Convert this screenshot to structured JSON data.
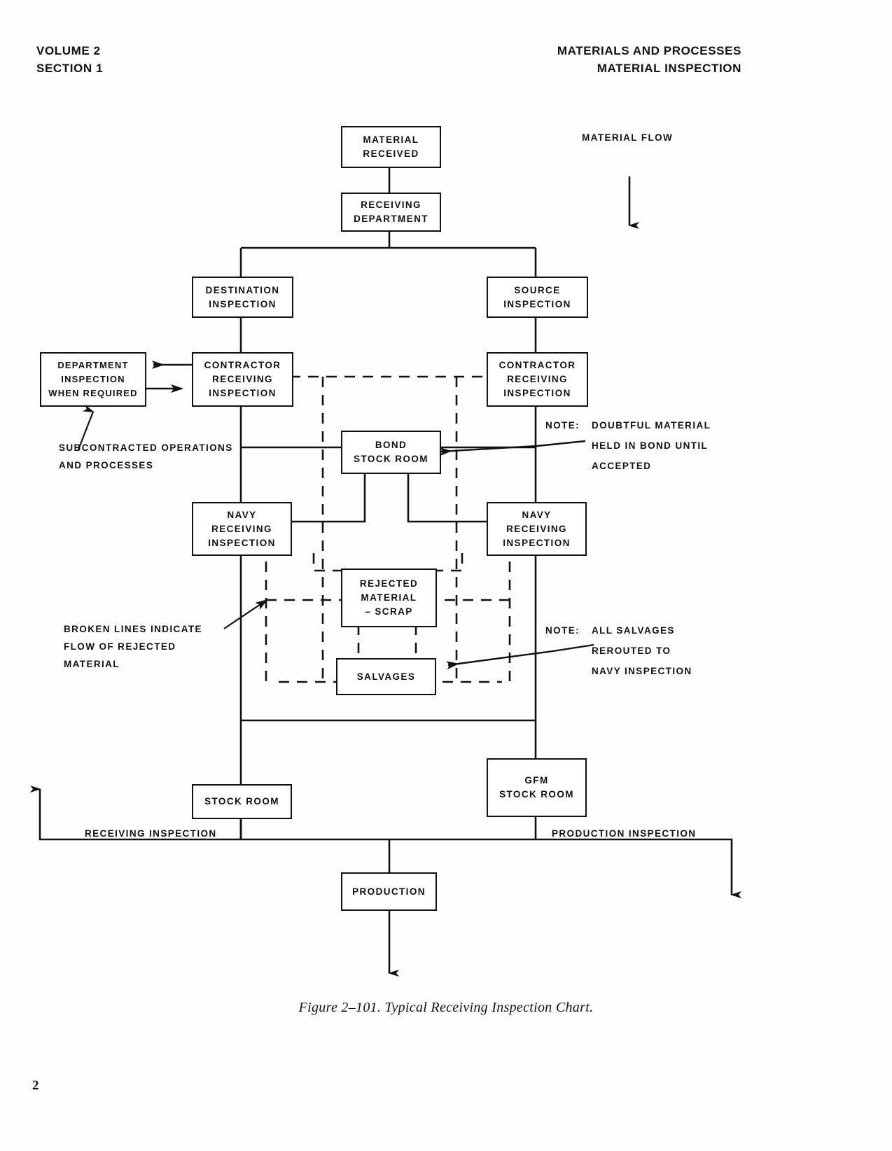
{
  "header": {
    "left_line1": "VOLUME 2",
    "left_line2": "SECTION 1",
    "right_line1": "MATERIALS AND PROCESSES",
    "right_line2": "MATERIAL INSPECTION"
  },
  "page_number": "2",
  "caption": "Figure 2–101.   Typical Receiving Inspection Chart.",
  "legend": {
    "material_flow": "MATERIAL FLOW"
  },
  "annotations": {
    "subcontracted_line1": "SUBCONTRACTED OPERATIONS",
    "subcontracted_line2": "AND PROCESSES",
    "broken_lines_line1": "BROKEN LINES INDICATE",
    "broken_lines_line2": "FLOW OF REJECTED",
    "broken_lines_line3": "MATERIAL",
    "note_label": "NOTE:",
    "note1_line1": "DOUBTFUL MATERIAL",
    "note1_line2": "HELD IN BOND UNTIL",
    "note1_line3": "ACCEPTED",
    "note2_line1": "ALL SALVAGES",
    "note2_line2": "REROUTED TO",
    "note2_line3": "NAVY INSPECTION",
    "receiving_inspection": "RECEIVING INSPECTION",
    "production_inspection": "PRODUCTION INSPECTION"
  },
  "chart_data": {
    "type": "diagram",
    "title": "Typical Receiving Inspection Chart",
    "nodes": [
      {
        "id": "material_received",
        "lines": [
          "MATERIAL",
          "RECEIVED"
        ]
      },
      {
        "id": "receiving_department",
        "lines": [
          "RECEIVING",
          "DEPARTMENT"
        ]
      },
      {
        "id": "destination_inspection",
        "lines": [
          "DESTINATION",
          "INSPECTION"
        ]
      },
      {
        "id": "source_inspection",
        "lines": [
          "SOURCE",
          "INSPECTION"
        ]
      },
      {
        "id": "contractor_left",
        "lines": [
          "CONTRACTOR",
          "RECEIVING",
          "INSPECTION"
        ]
      },
      {
        "id": "contractor_right",
        "lines": [
          "CONTRACTOR",
          "RECEIVING",
          "INSPECTION"
        ]
      },
      {
        "id": "department_inspection",
        "lines": [
          "DEPARTMENT",
          "INSPECTION",
          "WHEN REQUIRED"
        ]
      },
      {
        "id": "bond_stock_room",
        "lines": [
          "BOND",
          "STOCK ROOM"
        ]
      },
      {
        "id": "navy_left",
        "lines": [
          "NAVY",
          "RECEIVING",
          "INSPECTION"
        ]
      },
      {
        "id": "navy_right",
        "lines": [
          "NAVY",
          "RECEIVING",
          "INSPECTION"
        ]
      },
      {
        "id": "rejected_material",
        "lines": [
          "REJECTED",
          "MATERIAL",
          "– SCRAP"
        ]
      },
      {
        "id": "salvages",
        "lines": [
          "SALVAGES"
        ]
      },
      {
        "id": "stock_room",
        "lines": [
          "STOCK ROOM"
        ]
      },
      {
        "id": "gfm_stock_room",
        "lines": [
          "GFM",
          "STOCK ROOM"
        ]
      },
      {
        "id": "production",
        "lines": [
          "PRODUCTION"
        ]
      }
    ],
    "edges": [
      {
        "from": "material_received",
        "to": "receiving_department",
        "style": "solid"
      },
      {
        "from": "receiving_department",
        "to": "destination_inspection",
        "style": "solid"
      },
      {
        "from": "receiving_department",
        "to": "source_inspection",
        "style": "solid"
      },
      {
        "from": "destination_inspection",
        "to": "contractor_left",
        "style": "solid"
      },
      {
        "from": "source_inspection",
        "to": "contractor_right",
        "style": "solid"
      },
      {
        "from": "contractor_left",
        "to": "department_inspection",
        "style": "solid"
      },
      {
        "from": "department_inspection",
        "to": "contractor_left",
        "style": "solid"
      },
      {
        "from": "contractor_left",
        "to": "bond_stock_room",
        "style": "solid"
      },
      {
        "from": "contractor_right",
        "to": "bond_stock_room",
        "style": "solid"
      },
      {
        "from": "contractor_left",
        "to": "navy_left",
        "style": "solid"
      },
      {
        "from": "contractor_right",
        "to": "navy_right",
        "style": "solid"
      },
      {
        "from": "bond_stock_room",
        "to": "navy_left",
        "style": "solid"
      },
      {
        "from": "bond_stock_room",
        "to": "navy_right",
        "style": "solid"
      },
      {
        "from": "contractor_left",
        "to": "rejected_material",
        "style": "dashed"
      },
      {
        "from": "contractor_right",
        "to": "rejected_material",
        "style": "dashed"
      },
      {
        "from": "navy_left",
        "to": "rejected_material",
        "style": "dashed"
      },
      {
        "from": "navy_right",
        "to": "rejected_material",
        "style": "dashed"
      },
      {
        "from": "rejected_material",
        "to": "salvages",
        "style": "dashed"
      },
      {
        "from": "navy_left",
        "to": "stock_room",
        "style": "solid"
      },
      {
        "from": "navy_right",
        "to": "gfm_stock_room",
        "style": "solid"
      },
      {
        "from": "stock_room",
        "to": "production",
        "style": "solid"
      },
      {
        "from": "gfm_stock_room",
        "to": "production",
        "style": "solid"
      }
    ],
    "legend_entries": [
      {
        "label": "MATERIAL FLOW",
        "style": "solid-arrow-down"
      },
      {
        "label": "BROKEN LINES INDICATE FLOW OF REJECTED MATERIAL",
        "style": "dashed"
      }
    ]
  }
}
